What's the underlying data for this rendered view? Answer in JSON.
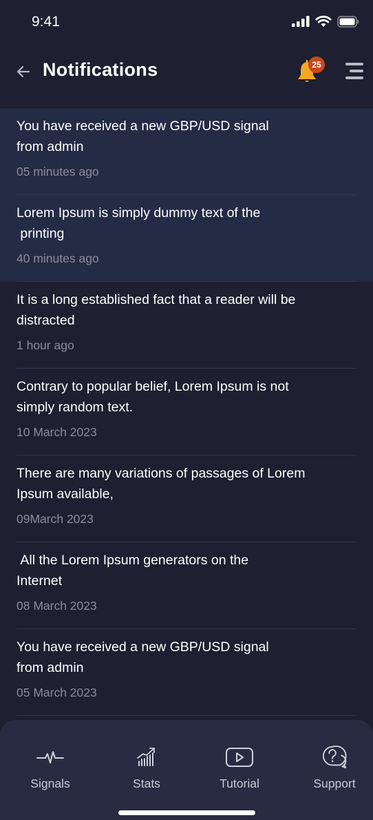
{
  "status_bar": {
    "time": "9:41"
  },
  "header": {
    "title": "Notifications",
    "badge_count": "25"
  },
  "notifications": [
    {
      "message": "You have received a new GBP/USD signal\nfrom admin",
      "time": "05 minutes ago",
      "unread": true
    },
    {
      "message": "Lorem Ipsum is simply dummy text of the\n printing",
      "time": "40 minutes ago",
      "unread": true
    },
    {
      "message": "It is a long established fact that a reader will be\ndistracted",
      "time": "1 hour ago",
      "unread": false
    },
    {
      "message": "Contrary to popular belief, Lorem Ipsum is not\nsimply random text.",
      "time": "10 March 2023",
      "unread": false
    },
    {
      "message": "There are many variations of passages of Lorem\nIpsum available,",
      "time": "09March 2023",
      "unread": false
    },
    {
      "message": " All the Lorem Ipsum generators on the\nInternet",
      "time": "08 March 2023",
      "unread": false
    },
    {
      "message": "You have received a new GBP/USD signal\nfrom admin",
      "time": "05 March 2023",
      "unread": false
    }
  ],
  "bottom_nav": [
    {
      "label": "Signals",
      "icon": "pulse-icon"
    },
    {
      "label": "Stats",
      "icon": "stats-chart-icon"
    },
    {
      "label": "Tutorial",
      "icon": "play-video-icon"
    },
    {
      "label": "Support",
      "icon": "help-chat-icon"
    }
  ],
  "colors": {
    "background": "#1e1f30",
    "unread_row": "#242b45",
    "badge": "#c9481c",
    "bell": "#f5a623",
    "nav_bg": "#292b42"
  }
}
